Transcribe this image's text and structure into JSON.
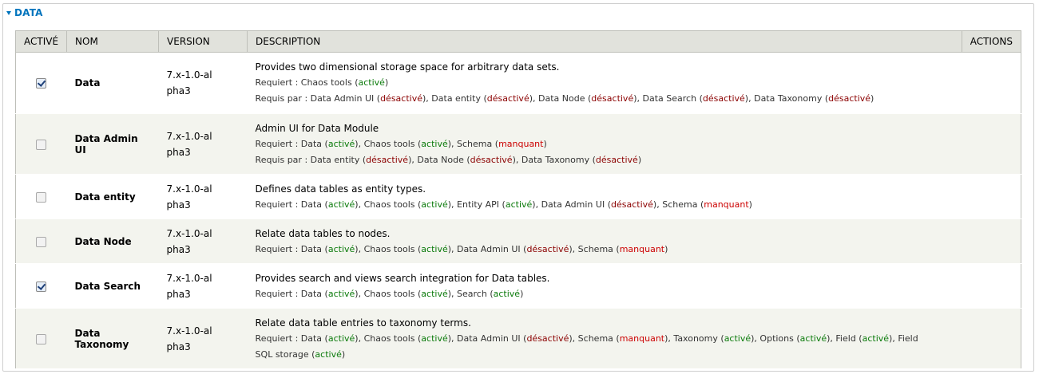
{
  "fieldset": {
    "legend": "DATA"
  },
  "headers": {
    "enabled": "ACTIVÉ",
    "name": "NOM",
    "version": "VERSION",
    "description": "DESCRIPTION",
    "actions": "ACTIONS"
  },
  "labels": {
    "requires": "Requiert : ",
    "required_by": "Requis par : "
  },
  "status_text": {
    "on": "activé",
    "off": "désactivé",
    "missing": "manquant"
  },
  "colors": {
    "legend": "#0074bd",
    "enabled": "#0a7a0a",
    "disabled": "#8b0000",
    "missing": "#cc0000",
    "header_bg": "#e1e2dc",
    "stripe_bg": "#f3f4ee"
  },
  "modules": [
    {
      "checked": true,
      "name": "Data",
      "version": "7.x-1.0-alpha3",
      "height": 77,
      "description": "Provides two dimensional storage space for arbitrary data sets.",
      "requires": [
        {
          "name": "Chaos tools",
          "status": "on"
        }
      ],
      "required_by": [
        {
          "name": "Data Admin UI",
          "status": "off"
        },
        {
          "name": "Data entity",
          "status": "off"
        },
        {
          "name": "Data Node",
          "status": "off"
        },
        {
          "name": "Data Search",
          "status": "off"
        },
        {
          "name": "Data Taxonomy",
          "status": "off"
        }
      ]
    },
    {
      "checked": false,
      "name": "Data Admin UI",
      "version": "7.x-1.0-alpha3",
      "height": 76,
      "description": "Admin UI for Data Module",
      "requires": [
        {
          "name": "Data",
          "status": "on"
        },
        {
          "name": "Chaos tools",
          "status": "on"
        },
        {
          "name": "Schema",
          "status": "missing"
        }
      ],
      "required_by": [
        {
          "name": "Data entity",
          "status": "off"
        },
        {
          "name": "Data Node",
          "status": "off"
        },
        {
          "name": "Data Taxonomy",
          "status": "off"
        }
      ]
    },
    {
      "checked": false,
      "name": "Data entity",
      "version": "7.x-1.0-alpha3",
      "height": 56,
      "description": "Defines data tables as entity types.",
      "requires": [
        {
          "name": "Data",
          "status": "on"
        },
        {
          "name": "Chaos tools",
          "status": "on"
        },
        {
          "name": "Entity API",
          "status": "on"
        },
        {
          "name": "Data Admin UI",
          "status": "off"
        },
        {
          "name": "Schema",
          "status": "missing"
        }
      ],
      "required_by": []
    },
    {
      "checked": false,
      "name": "Data Node",
      "version": "7.x-1.0-alpha3",
      "height": 56,
      "description": "Relate data tables to nodes.",
      "requires": [
        {
          "name": "Data",
          "status": "on"
        },
        {
          "name": "Chaos tools",
          "status": "on"
        },
        {
          "name": "Data Admin UI",
          "status": "off"
        },
        {
          "name": "Schema",
          "status": "missing"
        }
      ],
      "required_by": []
    },
    {
      "checked": true,
      "name": "Data Search",
      "version": "7.x-1.0-alpha3",
      "height": 56,
      "description": "Provides search and views search integration for Data tables.",
      "requires": [
        {
          "name": "Data",
          "status": "on"
        },
        {
          "name": "Chaos tools",
          "status": "on"
        },
        {
          "name": "Search",
          "status": "on"
        }
      ],
      "required_by": []
    },
    {
      "checked": false,
      "name": "Data Taxonomy",
      "version": "7.x-1.0-alpha3",
      "height": 76,
      "description": "Relate data table entries to taxonomy terms.",
      "requires": [
        {
          "name": "Data",
          "status": "on"
        },
        {
          "name": "Chaos tools",
          "status": "on"
        },
        {
          "name": "Data Admin UI",
          "status": "off"
        },
        {
          "name": "Schema",
          "status": "missing"
        },
        {
          "name": "Taxonomy",
          "status": "on"
        },
        {
          "name": "Options",
          "status": "on"
        },
        {
          "name": "Field",
          "status": "on"
        },
        {
          "name": "Field SQL storage",
          "status": "on"
        }
      ],
      "required_by": []
    }
  ]
}
